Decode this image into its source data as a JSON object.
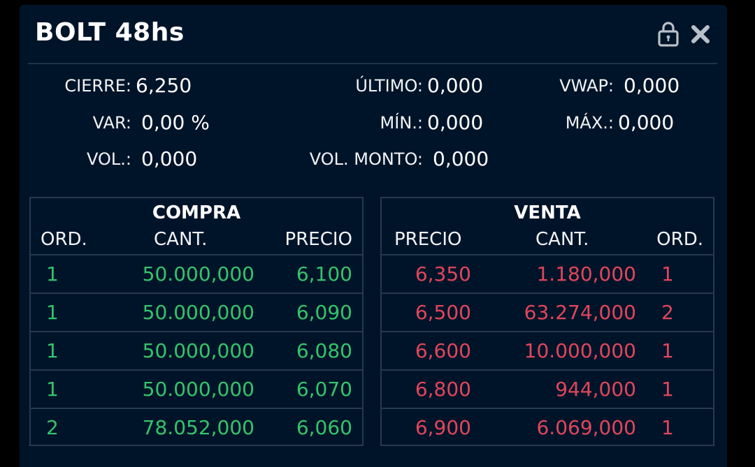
{
  "header": {
    "title": "BOLT 48hs",
    "lock_icon": "lock-icon",
    "close_icon": "close-icon"
  },
  "stats": {
    "cierre": {
      "label": "CIERRE:",
      "value": "6,250"
    },
    "ultimo": {
      "label": "ÚLTIMO:",
      "value": "0,000"
    },
    "vwap": {
      "label": "VWAP:",
      "value": "0,000"
    },
    "var": {
      "label": "VAR:",
      "value": "0,00 %"
    },
    "min": {
      "label": "MÍN.:",
      "value": "0,000"
    },
    "max": {
      "label": "MÁX.:",
      "value": "0,000"
    },
    "vol": {
      "label": "VOL.:",
      "value": "0,000"
    },
    "vol_monto": {
      "label": "VOL. MONTO:",
      "value": "0,000"
    }
  },
  "compra": {
    "title": "COMPRA",
    "headers": {
      "ord": "ORD.",
      "cant": "CANT.",
      "precio": "PRECIO"
    },
    "rows": [
      {
        "ord": "1",
        "cant": "50.000,000",
        "precio": "6,100"
      },
      {
        "ord": "1",
        "cant": "50.000,000",
        "precio": "6,090"
      },
      {
        "ord": "1",
        "cant": "50.000,000",
        "precio": "6,080"
      },
      {
        "ord": "1",
        "cant": "50.000,000",
        "precio": "6,070"
      },
      {
        "ord": "2",
        "cant": "78.052,000",
        "precio": "6,060"
      }
    ]
  },
  "venta": {
    "title": "VENTA",
    "headers": {
      "precio": "PRECIO",
      "cant": "CANT.",
      "ord": "ORD."
    },
    "rows": [
      {
        "precio": "6,350",
        "cant": "1.180,000",
        "ord": "1"
      },
      {
        "precio": "6,500",
        "cant": "63.274,000",
        "ord": "2"
      },
      {
        "precio": "6,600",
        "cant": "10.000,000",
        "ord": "1"
      },
      {
        "precio": "6,800",
        "cant": "944,000",
        "ord": "1"
      },
      {
        "precio": "6,900",
        "cant": "6.069,000",
        "ord": "1"
      }
    ]
  },
  "colors": {
    "background": "#001429",
    "buy": "#34c46b",
    "sell": "#e0465c",
    "grid": "#26394d"
  }
}
